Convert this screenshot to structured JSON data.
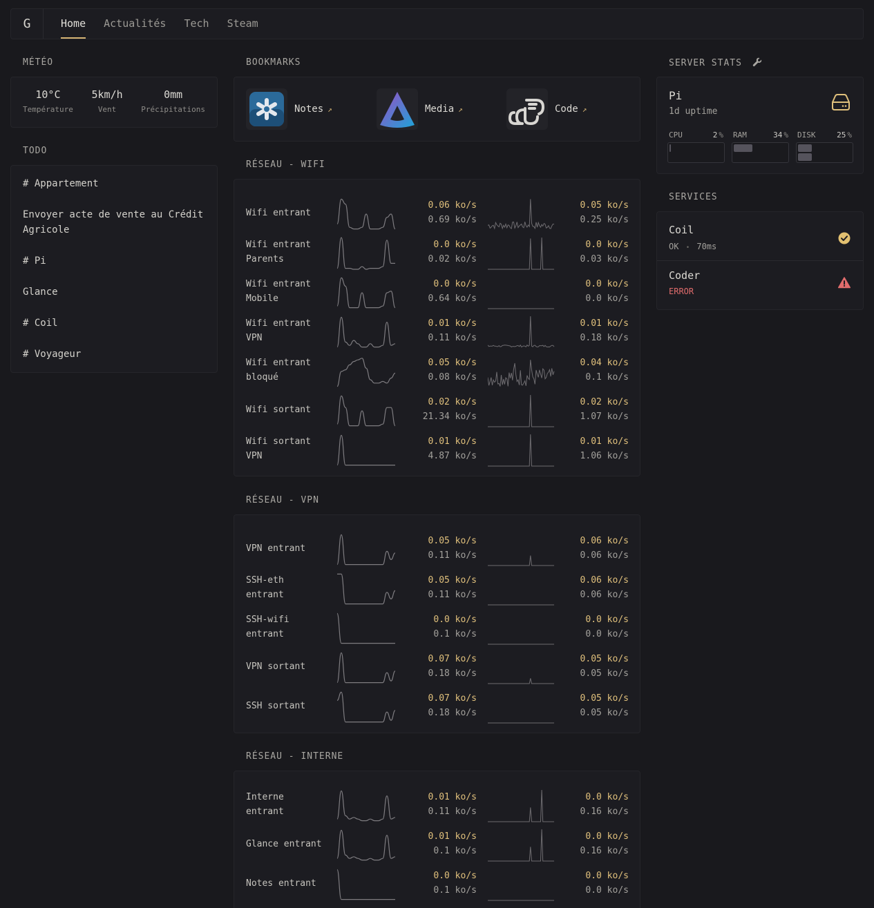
{
  "header": {
    "logo": "G",
    "tabs": [
      {
        "label": "Home",
        "active": true
      },
      {
        "label": "Actualités",
        "active": false
      },
      {
        "label": "Tech",
        "active": false
      },
      {
        "label": "Steam",
        "active": false
      }
    ]
  },
  "meteo": {
    "title": "MÉTÉO",
    "items": [
      {
        "value": "10°C",
        "label": "Température"
      },
      {
        "value": "5km/h",
        "label": "Vent"
      },
      {
        "value": "0mm",
        "label": "Précipitations"
      }
    ]
  },
  "todo": {
    "title": "TODO",
    "lines": [
      "# Appartement",
      "Envoyer acte de vente au Crédit",
      "Agricole",
      "# Pi",
      "Glance",
      "# Coil",
      "# Voyageur"
    ]
  },
  "bookmarks": {
    "title": "BOOKMARKS",
    "items": [
      {
        "label": "Notes",
        "arrow": "↗",
        "icon": "notes-app-icon"
      },
      {
        "label": "Media",
        "arrow": "↗",
        "icon": "media-app-icon"
      },
      {
        "label": "Code",
        "arrow": "↗",
        "icon": "code-app-icon"
      }
    ]
  },
  "wifi": {
    "title": "RÉSEAU - WIFI",
    "rows": [
      {
        "name1": "Wifi entrant",
        "name2": "",
        "v1": "0.06 ko/s",
        "v1b": "0.69 ko/s",
        "v2": "0.05 ko/s",
        "v2b": "0.25 ko/s",
        "s1": [
          0.2,
          0.95,
          0.8,
          0.1,
          0.05,
          0.05,
          0.1,
          0.5,
          0.05,
          0.05,
          0.05,
          0.1,
          0.4,
          0.5,
          0.05
        ],
        "s2": "noise"
      },
      {
        "name1": "Wifi entrant",
        "name2": "Parents",
        "v1": "0.0 ko/s",
        "v1b": "0.02 ko/s",
        "v2": "0.0 ko/s",
        "v2b": "0.03 ko/s",
        "s1": [
          0.05,
          0.98,
          0.05,
          0.05,
          0.02,
          0.02,
          0.1,
          0.02,
          0.05,
          0.05,
          0.05,
          0.1,
          0.9,
          0.2,
          0.2
        ],
        "s2": "twin"
      },
      {
        "name1": "Wifi entrant",
        "name2": "Mobile",
        "v1": "0.0 ko/s",
        "v1b": "0.64 ko/s",
        "v2": "0.0 ko/s",
        "v2b": "0.0 ko/s",
        "s1": [
          0.1,
          0.95,
          0.7,
          0.05,
          0.05,
          0.05,
          0.5,
          0.05,
          0.05,
          0.05,
          0.05,
          0.1,
          0.5,
          0.55,
          0.05
        ],
        "s2": "flat"
      },
      {
        "name1": "Wifi entrant",
        "name2": "VPN",
        "v1": "0.01 ko/s",
        "v1b": "0.11 ko/s",
        "v2": "0.01 ko/s",
        "v2b": "0.18 ko/s",
        "s1": [
          0.05,
          0.95,
          0.2,
          0.1,
          0.25,
          0.15,
          0.05,
          0.05,
          0.15,
          0.05,
          0.05,
          0.1,
          0.8,
          0.1,
          0.15
        ],
        "s2": "spikeNoise"
      },
      {
        "name1": "Wifi entrant",
        "name2": "bloqué",
        "v1": "0.05 ko/s",
        "v1b": "0.08 ko/s",
        "v2": "0.04 ko/s",
        "v2b": "0.1 ko/s",
        "s1": [
          0.05,
          0.5,
          0.55,
          0.7,
          0.8,
          0.85,
          0.9,
          0.6,
          0.25,
          0.15,
          0.15,
          0.2,
          0.15,
          0.3,
          0.45
        ],
        "s2": "bigNoise"
      },
      {
        "name1": "Wifi sortant",
        "name2": "",
        "v1": "0.02 ko/s",
        "v1b": "21.34 ko/s",
        "v2": "0.02 ko/s",
        "v2b": "1.07 ko/s",
        "s1": [
          0.1,
          0.95,
          0.6,
          0.05,
          0.05,
          0.05,
          0.5,
          0.05,
          0.05,
          0.05,
          0.05,
          0.1,
          0.6,
          0.6,
          0.05
        ],
        "s2": "spike"
      },
      {
        "name1": "Wifi sortant",
        "name2": "VPN",
        "v1": "0.01 ko/s",
        "v1b": "4.87 ko/s",
        "v2": "0.01 ko/s",
        "v2b": "1.06 ko/s",
        "s1": [
          0.05,
          0.95,
          0.05,
          0.05,
          0.05,
          0.05,
          0.05,
          0.05,
          0.05,
          0.05,
          0.05,
          0.05,
          0.05,
          0.05,
          0.05
        ],
        "s2": "spike"
      }
    ]
  },
  "vpn": {
    "title": "RÉSEAU - VPN",
    "rows": [
      {
        "name1": "VPN entrant",
        "name2": "",
        "v1": "0.05 ko/s",
        "v1b": "0.11 ko/s",
        "v2": "0.06 ko/s",
        "v2b": "0.06 ko/s",
        "s1": [
          0.05,
          0.95,
          0.05,
          0.05,
          0.05,
          0.05,
          0.05,
          0.05,
          0.05,
          0.05,
          0.05,
          0.05,
          0.45,
          0.2,
          0.4
        ],
        "s2": "small"
      },
      {
        "name1": "SSH-eth",
        "name2": "entrant",
        "v1": "0.05 ko/s",
        "v1b": "0.11 ko/s",
        "v2": "0.06 ko/s",
        "v2b": "0.06 ko/s",
        "s1": [
          0.95,
          0.95,
          0.05,
          0.05,
          0.05,
          0.05,
          0.05,
          0.05,
          0.05,
          0.05,
          0.05,
          0.05,
          0.4,
          0.2,
          0.45
        ],
        "s2": "flat"
      },
      {
        "name1": "SSH-wifi",
        "name2": "entrant",
        "v1": "0.0 ko/s",
        "v1b": "0.1 ko/s",
        "v2": "0.0 ko/s",
        "v2b": "0.0 ko/s",
        "s1": [
          0.95,
          0.05,
          0.05,
          0.05,
          0.05,
          0.05,
          0.05,
          0.05,
          0.05,
          0.05,
          0.05,
          0.05,
          0.05,
          0.05,
          0.05
        ],
        "s2": "flat"
      },
      {
        "name1": "VPN sortant",
        "name2": "",
        "v1": "0.07 ko/s",
        "v1b": "0.18 ko/s",
        "v2": "0.05 ko/s",
        "v2b": "0.05 ko/s",
        "s1": [
          0.05,
          0.95,
          0.05,
          0.05,
          0.05,
          0.05,
          0.05,
          0.05,
          0.05,
          0.05,
          0.05,
          0.05,
          0.35,
          0.1,
          0.4
        ],
        "s2": "tiny"
      },
      {
        "name1": "SSH sortant",
        "name2": "",
        "v1": "0.07 ko/s",
        "v1b": "0.18 ko/s",
        "v2": "0.05 ko/s",
        "v2b": "0.05 ko/s",
        "s1": [
          0.7,
          0.95,
          0.05,
          0.05,
          0.05,
          0.05,
          0.05,
          0.05,
          0.05,
          0.05,
          0.05,
          0.05,
          0.35,
          0.1,
          0.4
        ],
        "s2": "flat"
      }
    ]
  },
  "interne": {
    "title": "RÉSEAU - INTERNE",
    "rows": [
      {
        "name1": "Interne",
        "name2": "entrant",
        "v1": "0.01 ko/s",
        "v1b": "0.11 ko/s",
        "v2": "0.0 ko/s",
        "v2b": "0.16 ko/s",
        "s1": [
          0.1,
          0.95,
          0.2,
          0.1,
          0.15,
          0.1,
          0.05,
          0.05,
          0.1,
          0.05,
          0.05,
          0.1,
          0.8,
          0.1,
          0.15
        ],
        "s2": "twin2"
      },
      {
        "name1": "Glance entrant",
        "name2": "",
        "v1": "0.01 ko/s",
        "v1b": "0.1 ko/s",
        "v2": "0.0 ko/s",
        "v2b": "0.16 ko/s",
        "s1": [
          0.1,
          0.95,
          0.2,
          0.1,
          0.15,
          0.1,
          0.05,
          0.05,
          0.1,
          0.05,
          0.05,
          0.1,
          0.8,
          0.1,
          0.15
        ],
        "s2": "twin2"
      },
      {
        "name1": "Notes entrant",
        "name2": "",
        "v1": "0.0 ko/s",
        "v1b": "0.1 ko/s",
        "v2": "0.0 ko/s",
        "v2b": "0.0 ko/s",
        "s1": [
          0.95,
          0.05,
          0.05,
          0.05,
          0.05,
          0.05,
          0.05,
          0.05,
          0.05,
          0.05,
          0.05,
          0.05,
          0.05,
          0.05,
          0.05
        ],
        "s2": "flat"
      }
    ]
  },
  "server": {
    "title": "SERVER STATS",
    "name": "Pi",
    "uptime": "1d uptime",
    "cpu": {
      "label": "CPU",
      "pct": "2",
      "value": 0.02
    },
    "ram": {
      "label": "RAM",
      "pct": "34",
      "value": 0.34
    },
    "disk": {
      "label": "DISK",
      "pct": "25",
      "value": 0.25
    },
    "unit": "%"
  },
  "services": {
    "title": "SERVICES",
    "items": [
      {
        "name": "Coil",
        "status": "OK",
        "dot": "•",
        "latency": "70ms",
        "state": "ok"
      },
      {
        "name": "Coder",
        "status": "ERROR",
        "state": "error"
      }
    ]
  },
  "colors": {
    "accent": "#d6b574",
    "ok": "#e2c070",
    "error": "#e06c6c"
  }
}
